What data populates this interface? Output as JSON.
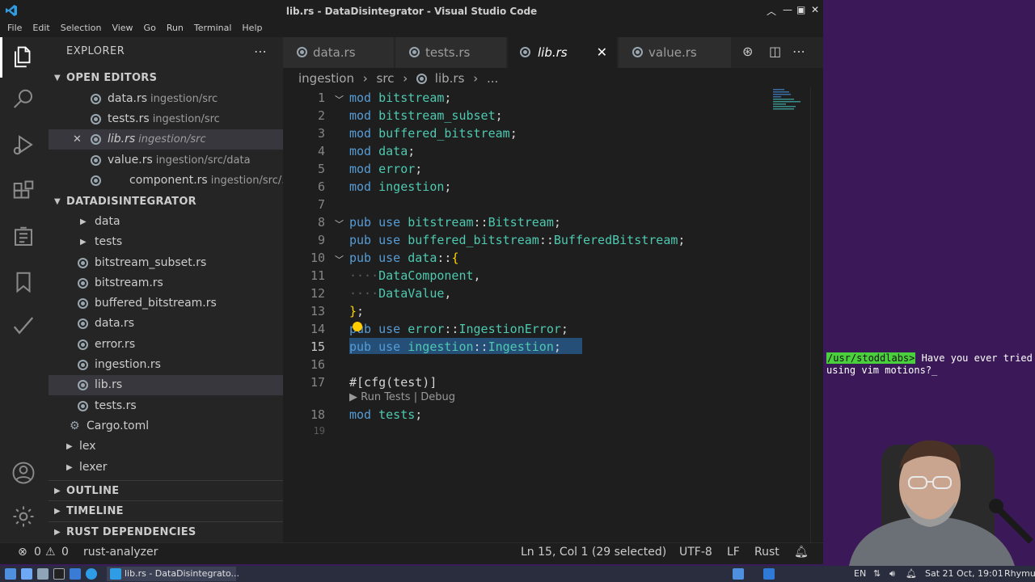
{
  "window": {
    "title": "lib.rs - DataDisintegrator - Visual Studio Code"
  },
  "menu": [
    "File",
    "Edit",
    "Selection",
    "View",
    "Go",
    "Run",
    "Terminal",
    "Help"
  ],
  "explorer": {
    "title": "EXPLORER",
    "open_editors": {
      "label": "OPEN EDITORS",
      "items": [
        {
          "name": "data.rs",
          "path": "ingestion/src"
        },
        {
          "name": "tests.rs",
          "path": "ingestion/src"
        },
        {
          "name": "lib.rs",
          "path": "ingestion/src"
        },
        {
          "name": "value.rs",
          "path": "ingestion/src/data"
        },
        {
          "name": "component.rs",
          "path": "ingestion/src/..."
        }
      ]
    },
    "project": {
      "label": "DATADISINTEGRATOR",
      "folders": [
        "data",
        "tests"
      ],
      "files": [
        "bitstream_subset.rs",
        "bitstream.rs",
        "buffered_bitstream.rs",
        "data.rs",
        "error.rs",
        "ingestion.rs",
        "lib.rs",
        "tests.rs"
      ],
      "cargo": "Cargo.toml",
      "root_folders": [
        "lex",
        "lexer"
      ]
    },
    "sections": [
      "OUTLINE",
      "TIMELINE",
      "RUST DEPENDENCIES"
    ]
  },
  "tabs": [
    {
      "label": "data.rs"
    },
    {
      "label": "tests.rs"
    },
    {
      "label": "lib.rs",
      "active": true
    },
    {
      "label": "value.rs"
    }
  ],
  "breadcrumb": [
    "ingestion",
    "›",
    "src",
    "›",
    "lib.rs",
    "›",
    "..."
  ],
  "editor": {
    "line_numbers": [
      "1",
      "2",
      "3",
      "4",
      "5",
      "6",
      "7",
      "8",
      "9",
      "10",
      "11",
      "12",
      "13",
      "14",
      "15",
      "16",
      "17",
      "18",
      "19"
    ],
    "codelens": "▶ Run Tests | Debug",
    "selected_line": "15"
  },
  "status": {
    "errors": "0",
    "warnings": "0",
    "analyzer": "rust-analyzer",
    "position": "Ln 15, Col 1 (29 selected)",
    "encoding": "UTF-8",
    "eol": "LF",
    "language": "Rust"
  },
  "taskbar": {
    "window_label": "lib.rs - DataDisintegrato...",
    "lang": "EN",
    "clock": "Sat 21 Oct, 19:01",
    "user": "Rhymu"
  },
  "overlay": {
    "prompt_user": "/usr/stoddlabs>",
    "prompt_text": "Have you ever tried using vim motions?",
    "cursor": "_"
  },
  "colors": {
    "accent_selection": "#264f78",
    "keyword": "#569cd6",
    "type": "#4ec9b0"
  }
}
